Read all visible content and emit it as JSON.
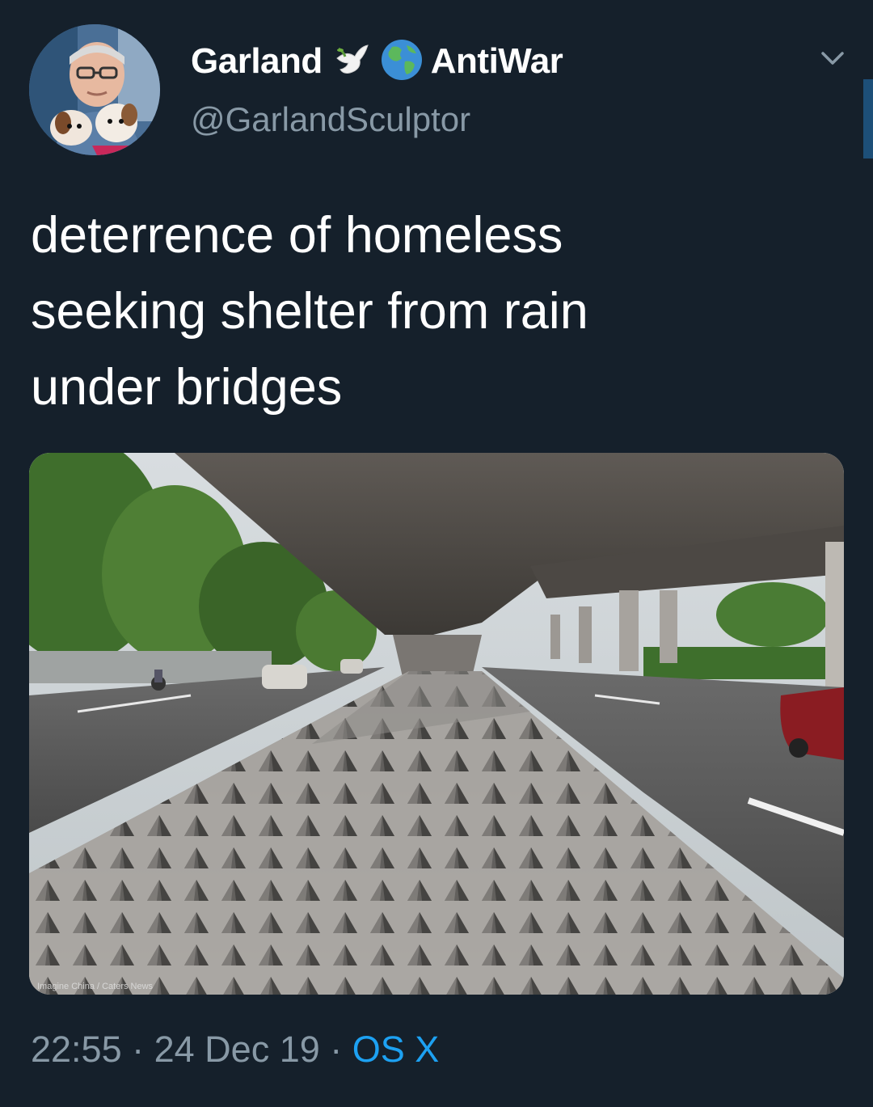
{
  "author": {
    "display_name": "Garland",
    "name_suffix": "AntiWar",
    "handle": "@GarlandSculptor",
    "name_emojis": [
      "dove-icon",
      "globe-icon"
    ]
  },
  "tweet": {
    "text": "deterrence of homeless\nseeking shelter from rain\nunder bridges",
    "photo_credit": "Imagine China / Caters News"
  },
  "meta": {
    "time": "22:55",
    "separator": " · ",
    "date": "24 Dec 19",
    "source": "OS X"
  },
  "colors": {
    "background": "#15202b",
    "secondary_text": "#8899a6",
    "link": "#1da1f2"
  }
}
